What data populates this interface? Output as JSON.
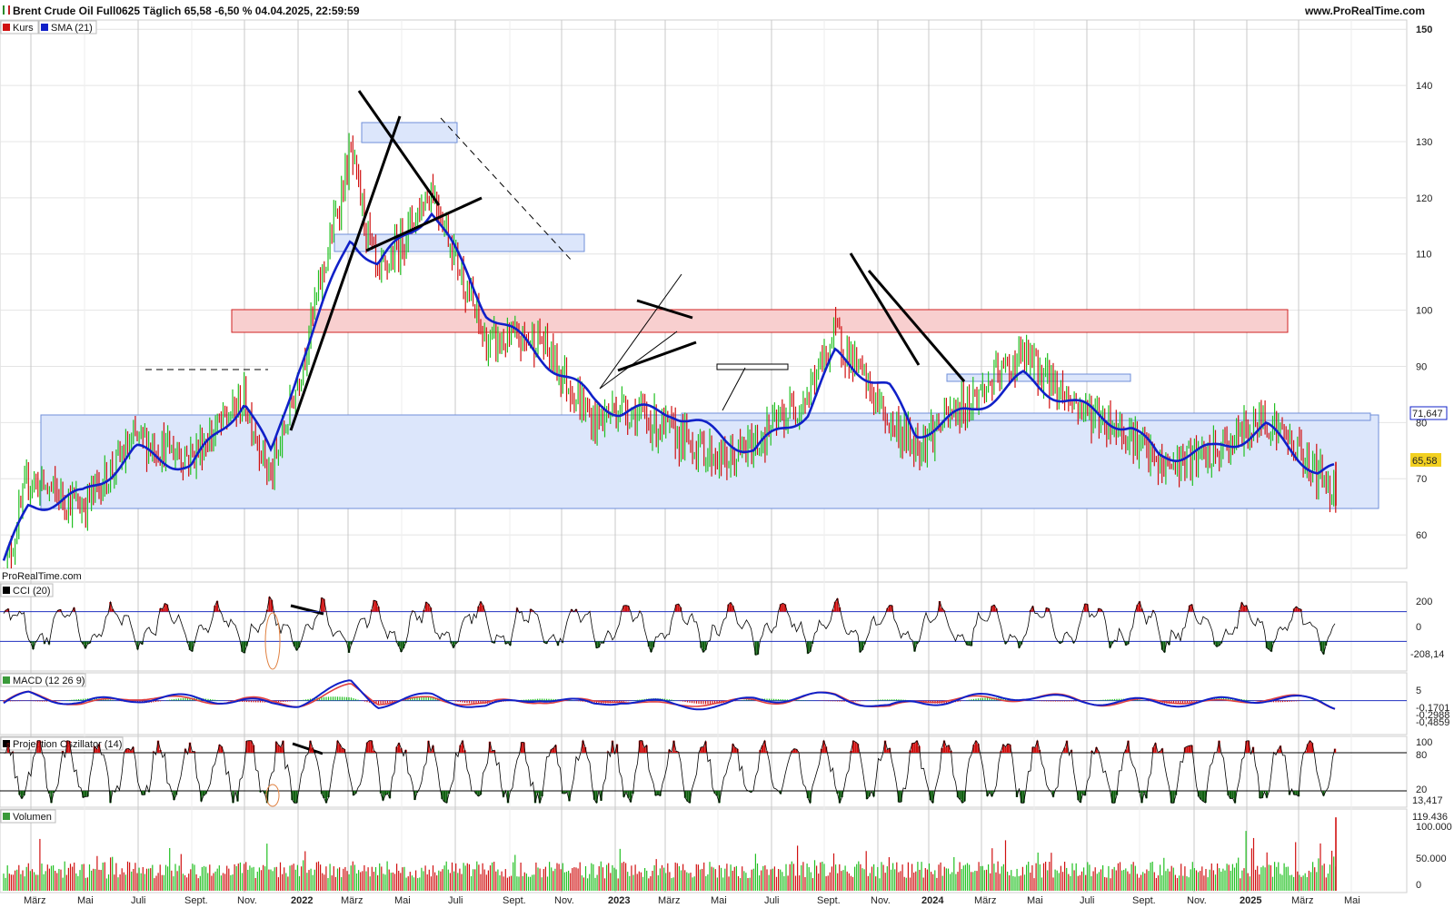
{
  "header": {
    "title": "Brent Crude Oil Full0625 Täglich 65,58 -6,50 % 04.04.2025, 22:59:59",
    "site": "www.ProRealTime.com",
    "watermark": "ProRealTime.com"
  },
  "colors": {
    "sma": "#1020c8",
    "up": "#22c022",
    "down": "#d01010",
    "zone_blue_fill": "#dce6fb",
    "zone_blue_stroke": "#6f8fd8",
    "zone_red_fill": "#f8cfcf",
    "zone_red_stroke": "#d02020",
    "last_price_bg": "#f2d020",
    "grid": "#e4e4e4"
  },
  "chart_data": [
    {
      "type": "line",
      "title": "",
      "legend": [
        {
          "name": "Kurs",
          "color": "#d01010"
        },
        {
          "name": "SMA (21)",
          "color": "#1020c8"
        }
      ],
      "x_ticks": [
        "März",
        "Mai",
        "Juli",
        "Sept.",
        "Nov.",
        "2022",
        "März",
        "Mai",
        "Juli",
        "Sept.",
        "Nov.",
        "2023",
        "März",
        "Mai",
        "Juli",
        "Sept.",
        "Nov.",
        "2024",
        "März",
        "Mai",
        "Juli",
        "Sept.",
        "Nov.",
        "2025",
        "März",
        "Mai"
      ],
      "y_ticks": [
        60,
        70,
        80,
        90,
        100,
        110,
        120,
        130,
        140,
        150
      ],
      "ylim": [
        55,
        151
      ],
      "labels": {
        "sma_last": "71,647",
        "price_last": "65,58"
      },
      "series": [
        {
          "name": "Kurs",
          "x": [
            "2021-02",
            "2021-03",
            "2021-05",
            "2021-07",
            "2021-09",
            "2021-11",
            "2021-12",
            "2022-01",
            "2022-03",
            "2022-04",
            "2022-06",
            "2022-08",
            "2022-10",
            "2022-12",
            "2023-01",
            "2023-03",
            "2023-05",
            "2023-06",
            "2023-08",
            "2023-09",
            "2023-11",
            "2023-12",
            "2024-02",
            "2024-04",
            "2024-06",
            "2024-08",
            "2024-09",
            "2024-11",
            "2025-01",
            "2025-02",
            "2025-03",
            "2025-04"
          ],
          "values": [
            52,
            70,
            65,
            77,
            74,
            84,
            70,
            88,
            128,
            105,
            122,
            94,
            95,
            80,
            83,
            78,
            73,
            76,
            85,
            96,
            80,
            76,
            84,
            92,
            83,
            78,
            72,
            74,
            81,
            76,
            71,
            65.58
          ]
        },
        {
          "name": "SMA (21)",
          "x": [
            "2021-02",
            "2021-03",
            "2021-05",
            "2021-07",
            "2021-09",
            "2021-11",
            "2021-12",
            "2022-01",
            "2022-03",
            "2022-04",
            "2022-06",
            "2022-08",
            "2022-10",
            "2022-12",
            "2023-01",
            "2023-03",
            "2023-05",
            "2023-06",
            "2023-08",
            "2023-09",
            "2023-11",
            "2023-12",
            "2024-02",
            "2024-04",
            "2024-06",
            "2024-08",
            "2024-09",
            "2024-11",
            "2025-01",
            "2025-02",
            "2025-03",
            "2025-04"
          ],
          "values": [
            55,
            65,
            67,
            75,
            72,
            84,
            74,
            90,
            113,
            108,
            118,
            100,
            92,
            84,
            82,
            82,
            77,
            75,
            82,
            92,
            86,
            78,
            82,
            88,
            83,
            79,
            74,
            75,
            79,
            75,
            71,
            71.647
          ]
        }
      ]
    },
    {
      "type": "line",
      "title": "CCI (20)",
      "y_ticks": [
        "200",
        "0"
      ],
      "ylim": [
        -300,
        300
      ],
      "levels": [
        100,
        -100
      ],
      "last_label": "-208,14"
    },
    {
      "type": "line",
      "title": "MACD (12 26 9)",
      "y_ticks": [
        "5"
      ],
      "ylim": [
        -8,
        10
      ],
      "last_labels": [
        "-0,1701",
        "-0,2988",
        "-0,4859"
      ]
    },
    {
      "type": "line",
      "title": "Projection Oszillator (14)",
      "y_ticks": [
        "100",
        "80",
        "20"
      ],
      "ylim": [
        0,
        100
      ],
      "levels": [
        80,
        20
      ],
      "last_label": "13,417"
    },
    {
      "type": "bar",
      "title": "Volumen",
      "y_ticks": [
        "100.000",
        "50.000",
        "0"
      ],
      "ylim": [
        0,
        130000
      ],
      "last_label": "119.436"
    }
  ]
}
